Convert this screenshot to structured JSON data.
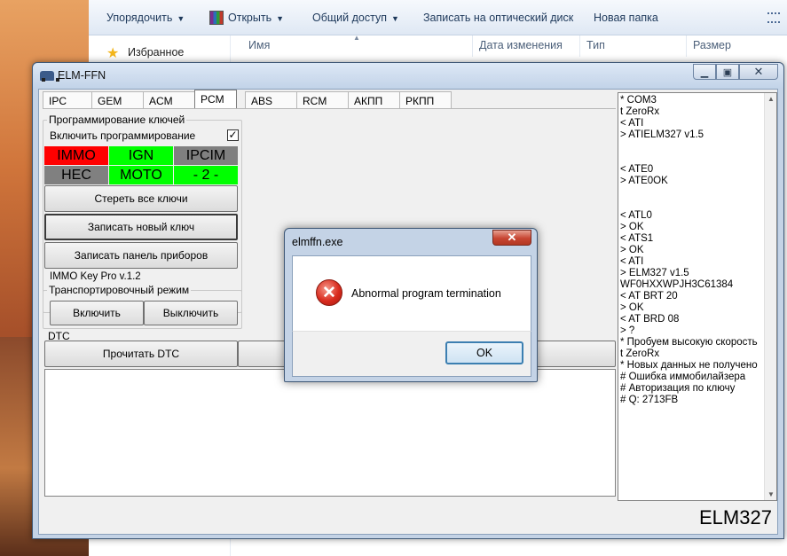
{
  "explorer": {
    "toolbar": {
      "organize": "Упорядочить",
      "open": "Открыть",
      "share": "Общий доступ",
      "burn": "Записать на оптический диск",
      "new_folder": "Новая папка"
    },
    "nav": {
      "favorites": "Избранное"
    },
    "columns": {
      "name": "Имя",
      "date": "Дата изменения",
      "type": "Тип",
      "size": "Размер"
    }
  },
  "app": {
    "title": "ELM-FFN",
    "tabs": [
      "IPC",
      "GEM",
      "ACM",
      "PCM",
      "ABS",
      "RCM",
      "АКПП",
      "РКПП"
    ],
    "active_tab": "PCM",
    "key_group": {
      "label": "Программирование ключей",
      "enable_label": "Включить программирование",
      "enable_checked": "✓",
      "status_cells": [
        {
          "text": "IMMO",
          "color": "#ff0000"
        },
        {
          "text": "IGN",
          "color": "#00ff00"
        },
        {
          "text": "IPCIM",
          "color": "#808080"
        },
        {
          "text": "HEC",
          "color": "#808080"
        },
        {
          "text": "MOTO",
          "color": "#00ff00"
        },
        {
          "text": "- 2 -",
          "color": "#00ff00"
        }
      ],
      "erase_all": "Стереть все ключи",
      "write_key": "Записать новый ключ",
      "write_cluster": "Записать панель приборов",
      "version": "IMMO Key Pro v.1.2"
    },
    "transport": {
      "label": "Транспортировочный режим",
      "on": "Включить",
      "off": "Выключить"
    },
    "dtc": {
      "label": "DTC",
      "read": "Прочитать DTC"
    },
    "log": [
      "* COM3",
      "t ZeroRx",
      "< ATI",
      "> ATIELM327 v1.5",
      "",
      "",
      "< ATE0",
      "> ATE0OK",
      "",
      "",
      "< ATL0",
      "> OK",
      "< ATS1",
      "> OK",
      "< ATI",
      "> ELM327 v1.5",
      "WF0HXXWPJH3C61384",
      "< AT BRT 20",
      "> OK",
      "< AT BRD 08",
      "> ?",
      "* Пробуем высокую скорость",
      "t ZeroRx",
      "* Новых данных не получено",
      "# Ошибка иммобилайзера",
      "# Авторизация по ключу",
      "# Q: 2713FB"
    ],
    "brand": "ELM327"
  },
  "dialog": {
    "title": "elmffn.exe",
    "message": "Abnormal program termination",
    "ok": "OK"
  }
}
